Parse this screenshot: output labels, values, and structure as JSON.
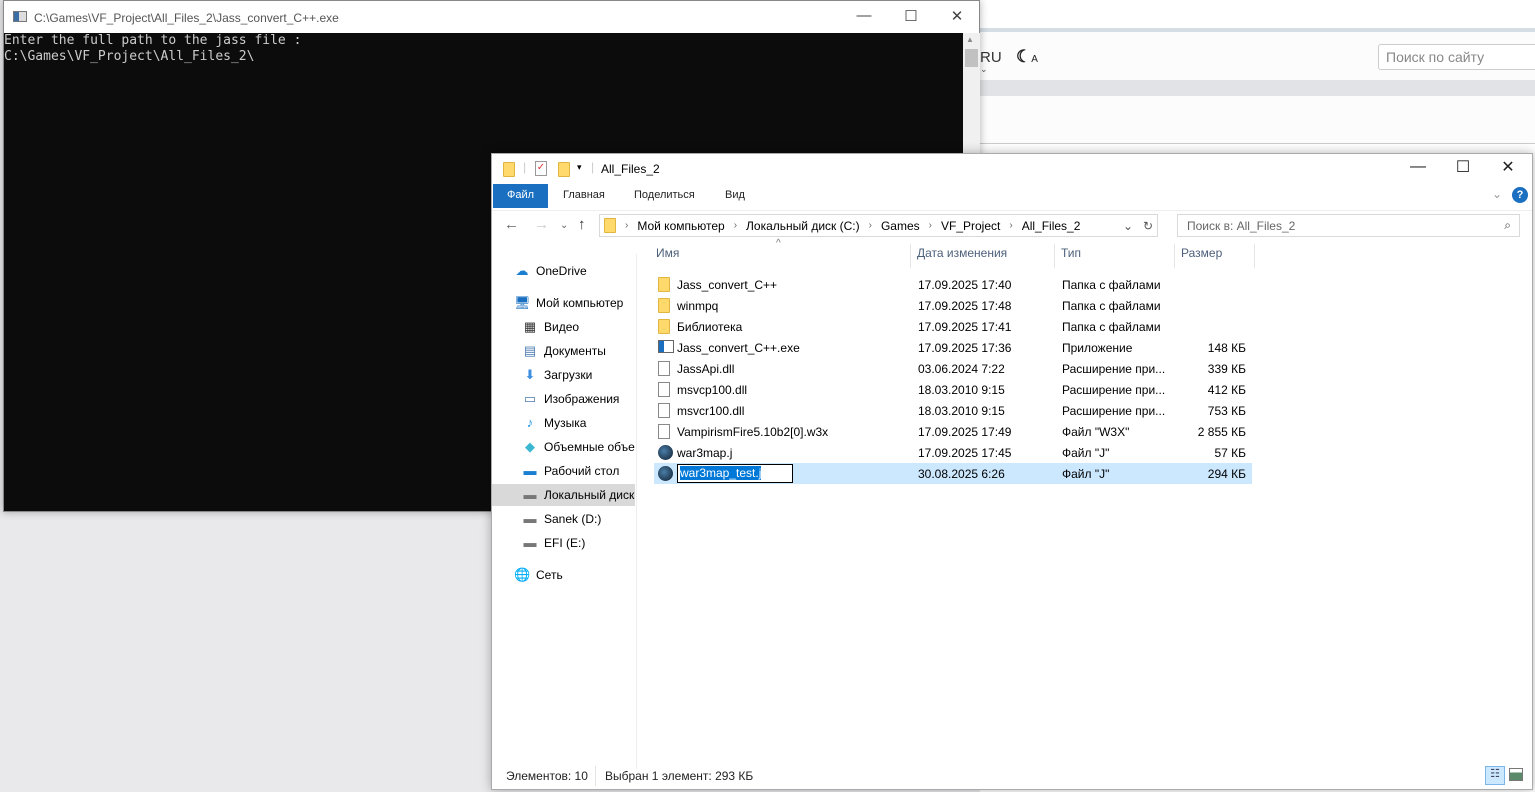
{
  "web": {
    "lang": "RU",
    "theme_label": "A",
    "search_placeholder": "Поиск по сайту"
  },
  "console": {
    "title": "C:\\Games\\VF_Project\\All_Files_2\\Jass_convert_C++.exe",
    "lines": [
      "Enter the full path to the jass file :",
      "C:\\Games\\VF_Project\\All_Files_2\\"
    ]
  },
  "explorer": {
    "title": "All_Files_2",
    "ribbon_tabs": [
      "Файл",
      "Главная",
      "Поделиться",
      "Вид"
    ],
    "breadcrumb": [
      "Мой компьютер",
      "Локальный диск (C:)",
      "Games",
      "VF_Project",
      "All_Files_2"
    ],
    "search_placeholder": "Поиск в: All_Files_2",
    "nav": [
      {
        "label": "OneDrive",
        "icon": "cloud-icon"
      },
      {
        "label": "Мой компьютер",
        "icon": "computer-icon"
      },
      {
        "label": "Видео",
        "icon": "video-icon"
      },
      {
        "label": "Документы",
        "icon": "documents-icon"
      },
      {
        "label": "Загрузки",
        "icon": "download-icon"
      },
      {
        "label": "Изображения",
        "icon": "pictures-icon"
      },
      {
        "label": "Музыка",
        "icon": "music-icon"
      },
      {
        "label": "Объемные объе",
        "icon": "3d-objects-icon"
      },
      {
        "label": "Рабочий стол",
        "icon": "desktop-icon"
      },
      {
        "label": "Локальный диск",
        "icon": "drive-icon"
      },
      {
        "label": "Sanek (D:)",
        "icon": "drive-icon"
      },
      {
        "label": "EFI (E:)",
        "icon": "drive-icon"
      },
      {
        "label": "Сеть",
        "icon": "network-icon"
      }
    ],
    "columns": [
      "Имя",
      "Дата изменения",
      "Тип",
      "Размер"
    ],
    "files": [
      {
        "name": "Jass_convert_C++",
        "date": "17.09.2025 17:40",
        "type": "Папка с файлами",
        "size": "",
        "icon": "folder"
      },
      {
        "name": "winmpq",
        "date": "17.09.2025 17:48",
        "type": "Папка с файлами",
        "size": "",
        "icon": "folder"
      },
      {
        "name": "Библиотека",
        "date": "17.09.2025 17:41",
        "type": "Папка с файлами",
        "size": "",
        "icon": "folder"
      },
      {
        "name": "Jass_convert_C++.exe",
        "date": "17.09.2025 17:36",
        "type": "Приложение",
        "size": "148 КБ",
        "icon": "exe"
      },
      {
        "name": "JassApi.dll",
        "date": "03.06.2024 7:22",
        "type": "Расширение при...",
        "size": "339 КБ",
        "icon": "dll"
      },
      {
        "name": "msvcp100.dll",
        "date": "18.03.2010 9:15",
        "type": "Расширение при...",
        "size": "412 КБ",
        "icon": "dll"
      },
      {
        "name": "msvcr100.dll",
        "date": "18.03.2010 9:15",
        "type": "Расширение при...",
        "size": "753 КБ",
        "icon": "dll"
      },
      {
        "name": "VampirismFire5.10b2[0].w3x",
        "date": "17.09.2025 17:49",
        "type": "Файл \"W3X\"",
        "size": "2 855 КБ",
        "icon": "file"
      },
      {
        "name": "war3map.j",
        "date": "17.09.2025 17:45",
        "type": "Файл \"J\"",
        "size": "57 КБ",
        "icon": "map"
      },
      {
        "name": "war3map_test.j",
        "date": "30.08.2025 6:26",
        "type": "Файл \"J\"",
        "size": "294 КБ",
        "icon": "map",
        "selected": true,
        "renaming": true
      }
    ],
    "status": {
      "count": "Элементов: 10",
      "selection": "Выбран 1 элемент: 293 КБ"
    }
  }
}
